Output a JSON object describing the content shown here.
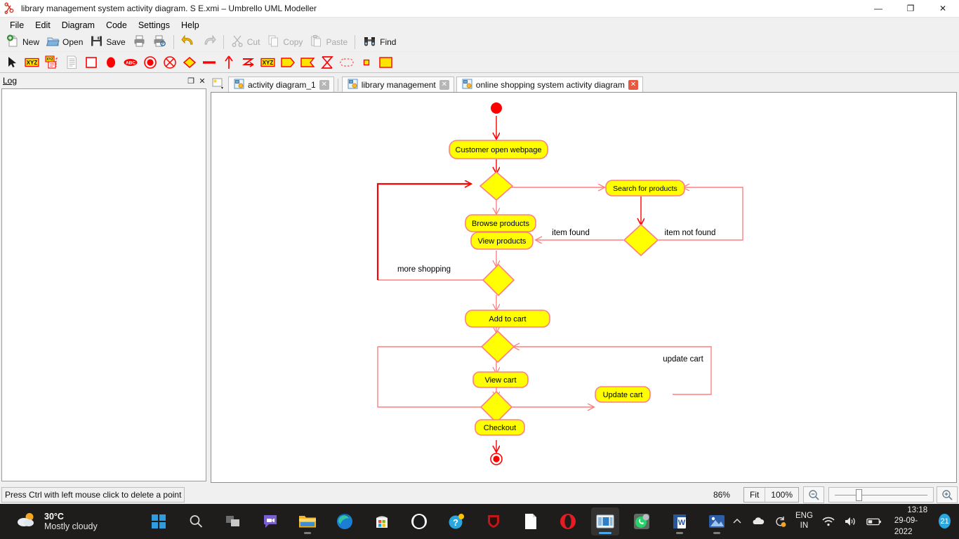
{
  "window": {
    "title": "library management system activity diagram. S E.xmi – Umbrello UML Modeller",
    "app_icon": "umbrello-icon",
    "minimize_label": "—",
    "maximize_label": "❐",
    "close_label": "✕"
  },
  "menubar": {
    "items": [
      {
        "label": "File"
      },
      {
        "label": "Edit"
      },
      {
        "label": "Diagram"
      },
      {
        "label": "Code"
      },
      {
        "label": "Settings"
      },
      {
        "label": "Help"
      }
    ]
  },
  "toolbar": {
    "buttons": [
      {
        "label": "New",
        "icon": "new-document-icon",
        "enabled": true
      },
      {
        "label": "Open",
        "icon": "open-folder-icon",
        "enabled": true
      },
      {
        "label": "Save",
        "icon": "floppy-save-icon",
        "enabled": true
      },
      {
        "label": "",
        "icon": "print-icon",
        "enabled": true
      },
      {
        "label": "",
        "icon": "print-preview-icon",
        "enabled": true
      },
      {
        "label": "",
        "icon": "undo-icon",
        "enabled": true
      },
      {
        "label": "",
        "icon": "redo-icon",
        "enabled": false
      },
      {
        "label": "Cut",
        "icon": "scissors-cut-icon",
        "enabled": false
      },
      {
        "label": "Copy",
        "icon": "copy-icon",
        "enabled": false
      },
      {
        "label": "Paste",
        "icon": "paste-icon",
        "enabled": false
      },
      {
        "label": "Find",
        "icon": "binoculars-find-icon",
        "enabled": true
      }
    ]
  },
  "shape_toolbar": {
    "tools": [
      {
        "name": "select-pointer-tool",
        "title": "Select"
      },
      {
        "name": "object-node-tool",
        "title": "Object Node"
      },
      {
        "name": "note-object-tool",
        "title": "Note Object"
      },
      {
        "name": "note-tool",
        "title": "Note"
      },
      {
        "name": "activity-box-tool",
        "title": "Box"
      },
      {
        "name": "initial-activity-tool",
        "title": "Initial Activity"
      },
      {
        "name": "activity-state-tool",
        "title": "Activity"
      },
      {
        "name": "end-activity-tool",
        "title": "End Activity"
      },
      {
        "name": "final-activity-tool",
        "title": "Final Activity"
      },
      {
        "name": "decision-branch-tool",
        "title": "Branch/Merge"
      },
      {
        "name": "fork-join-tool",
        "title": "Fork/Join"
      },
      {
        "name": "activity-transition-tool",
        "title": "Activity Transition"
      },
      {
        "name": "exception-tool",
        "title": "Exception"
      },
      {
        "name": "pin-tool",
        "title": "Pin"
      },
      {
        "name": "send-signal-tool",
        "title": "Send Signal"
      },
      {
        "name": "accept-signal-tool",
        "title": "Accept Signal"
      },
      {
        "name": "accept-time-event-tool",
        "title": "Accept Time Event"
      },
      {
        "name": "region-tool",
        "title": "Region"
      },
      {
        "name": "small-object-tool",
        "title": "Object"
      },
      {
        "name": "precondition-tool",
        "title": "Precondition"
      }
    ]
  },
  "log_dock": {
    "title": "Log",
    "float_label": "❐",
    "close_label": "✕",
    "content": ""
  },
  "tabs": {
    "list_button": "tab-list-button",
    "items": [
      {
        "label": "activity diagram_1",
        "active": false,
        "close": "✕"
      },
      {
        "label": "library management",
        "active": false,
        "close": "✕"
      },
      {
        "label": "online shopping system activity diagram",
        "active": true,
        "close": "✕"
      }
    ]
  },
  "diagram": {
    "title": "online shopping system activity diagram",
    "colors": {
      "node_fill": "#FFFF00",
      "node_stroke": "#FF7F7F",
      "edge": "#FF7F7F",
      "edge_selected": "#FF0000",
      "initial_node": "#FF0000",
      "text": "#000000"
    },
    "nodes": [
      {
        "id": "initial",
        "type": "initial-node",
        "label": ""
      },
      {
        "id": "customer-open-webpage",
        "type": "activity",
        "label": "Customer open webpage"
      },
      {
        "id": "decision-1",
        "type": "decision",
        "label": ""
      },
      {
        "id": "browse-products",
        "type": "activity",
        "label": "Browse products"
      },
      {
        "id": "search-for-products",
        "type": "activity",
        "label": "Search for products"
      },
      {
        "id": "decision-search",
        "type": "decision",
        "label": ""
      },
      {
        "id": "view-products",
        "type": "activity",
        "label": "View products"
      },
      {
        "id": "decision-2",
        "type": "decision",
        "label": ""
      },
      {
        "id": "add-to-cart",
        "type": "activity",
        "label": "Add to cart"
      },
      {
        "id": "decision-3",
        "type": "decision",
        "label": ""
      },
      {
        "id": "view-cart",
        "type": "activity",
        "label": "View cart"
      },
      {
        "id": "decision-4",
        "type": "decision",
        "label": ""
      },
      {
        "id": "update-cart",
        "type": "activity",
        "label": "Update cart"
      },
      {
        "id": "checkout",
        "type": "activity",
        "label": "Checkout"
      },
      {
        "id": "final",
        "type": "final-node",
        "label": ""
      }
    ],
    "edge_labels": [
      {
        "id": "item-found",
        "text": "item found"
      },
      {
        "id": "item-not-found",
        "text": "item not found"
      },
      {
        "id": "more-shopping",
        "text": "more shopping"
      },
      {
        "id": "update-cart-label",
        "text": "update cart"
      }
    ]
  },
  "statusbar": {
    "message": "Press Ctrl with left mouse click to delete a point",
    "zoom_percent": "86%",
    "fit_label": "Fit",
    "hundred_label": "100%",
    "zoom_out_icon": "zoom-out-icon",
    "zoom_in_icon": "zoom-in-icon"
  },
  "taskbar": {
    "weather": {
      "temperature": "30°C",
      "description": "Mostly cloudy",
      "icon": "partly-cloudy-icon"
    },
    "apps": [
      {
        "name": "start-button",
        "icon": "windows-logo-icon",
        "running": false,
        "active": false
      },
      {
        "name": "search-button",
        "icon": "search-icon",
        "running": false,
        "active": false
      },
      {
        "name": "task-view-button",
        "icon": "task-view-icon",
        "running": false,
        "active": false
      },
      {
        "name": "teams-chat",
        "icon": "chat-bubble-icon",
        "running": false,
        "active": false
      },
      {
        "name": "file-explorer",
        "icon": "folder-icon",
        "running": true,
        "active": false
      },
      {
        "name": "microsoft-edge",
        "icon": "edge-icon",
        "running": false,
        "active": false
      },
      {
        "name": "microsoft-store",
        "icon": "store-icon",
        "running": false,
        "active": false
      },
      {
        "name": "brave-browser",
        "icon": "brave-icon",
        "running": false,
        "active": false
      },
      {
        "name": "help-support",
        "icon": "help-icon",
        "running": false,
        "active": false
      },
      {
        "name": "mcafee",
        "icon": "shield-icon",
        "running": false,
        "active": false
      },
      {
        "name": "notepad",
        "icon": "document-icon",
        "running": false,
        "active": false
      },
      {
        "name": "opera-browser",
        "icon": "opera-icon",
        "running": false,
        "active": false
      },
      {
        "name": "umbrello",
        "icon": "umbrello-window-icon",
        "running": true,
        "active": true
      },
      {
        "name": "whatsapp",
        "icon": "whatsapp-icon",
        "running": true,
        "active": false
      },
      {
        "name": "microsoft-word",
        "icon": "word-icon",
        "running": true,
        "active": false
      },
      {
        "name": "photos",
        "icon": "photos-icon",
        "running": true,
        "active": false
      }
    ],
    "tray": {
      "chevron": "show-hidden-icons",
      "onedrive": "onedrive-icon",
      "updates": "update-icon",
      "language": {
        "line1": "ENG",
        "line2": "IN"
      },
      "wifi": "wifi-icon",
      "volume": "volume-icon",
      "battery": "battery-icon",
      "time": "13:18",
      "date": "29-09-2022",
      "notification_count": "21"
    }
  }
}
